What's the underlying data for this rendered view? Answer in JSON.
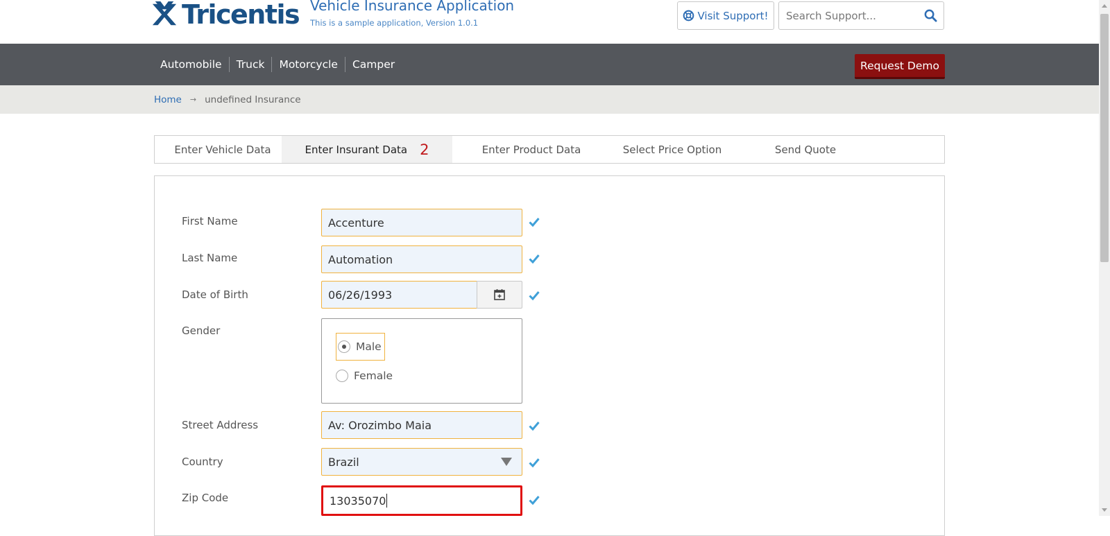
{
  "header": {
    "logo_text": "Tricentis",
    "app_title": "Vehicle Insurance Application",
    "app_subtitle": "This is a sample application, Version 1.0.1",
    "visit_support_label": "Visit Support!",
    "search_placeholder": "Search Support...",
    "search_icon": "search-icon",
    "support_icon": "lifebuoy-icon"
  },
  "nav": {
    "items": [
      {
        "label": "Automobile"
      },
      {
        "label": "Truck"
      },
      {
        "label": "Motorcycle"
      },
      {
        "label": "Camper"
      }
    ],
    "request_demo_label": "Request Demo"
  },
  "breadcrumb": {
    "home": "Home",
    "separator": "→",
    "current": "undefined Insurance"
  },
  "tabs": [
    {
      "label": "Enter Vehicle Data"
    },
    {
      "label": "Enter Insurant Data",
      "count": "2",
      "active": true
    },
    {
      "label": "Enter Product Data"
    },
    {
      "label": "Select Price Option"
    },
    {
      "label": "Send Quote"
    }
  ],
  "form": {
    "first_name": {
      "label": "First Name",
      "value": "Accenture"
    },
    "last_name": {
      "label": "Last Name",
      "value": "Automation"
    },
    "date_of_birth": {
      "label": "Date of Birth",
      "value": "06/26/1993"
    },
    "gender": {
      "label": "Gender",
      "options": [
        {
          "label": "Male",
          "selected": true
        },
        {
          "label": "Female",
          "selected": false
        }
      ]
    },
    "street_address": {
      "label": "Street Address",
      "value": "Av: Orozimbo Maia"
    },
    "country": {
      "label": "Country",
      "value": "Brazil"
    },
    "zip_code": {
      "label": "Zip Code",
      "value": "13035070"
    }
  },
  "colors": {
    "brand_blue": "#1a5186",
    "nav_bg": "#54575c",
    "demo_button": "#8b1010",
    "field_border": "#f0b23e",
    "field_bg": "#eef4fb",
    "error_border": "#e01010",
    "check": "#3fa0d8"
  }
}
